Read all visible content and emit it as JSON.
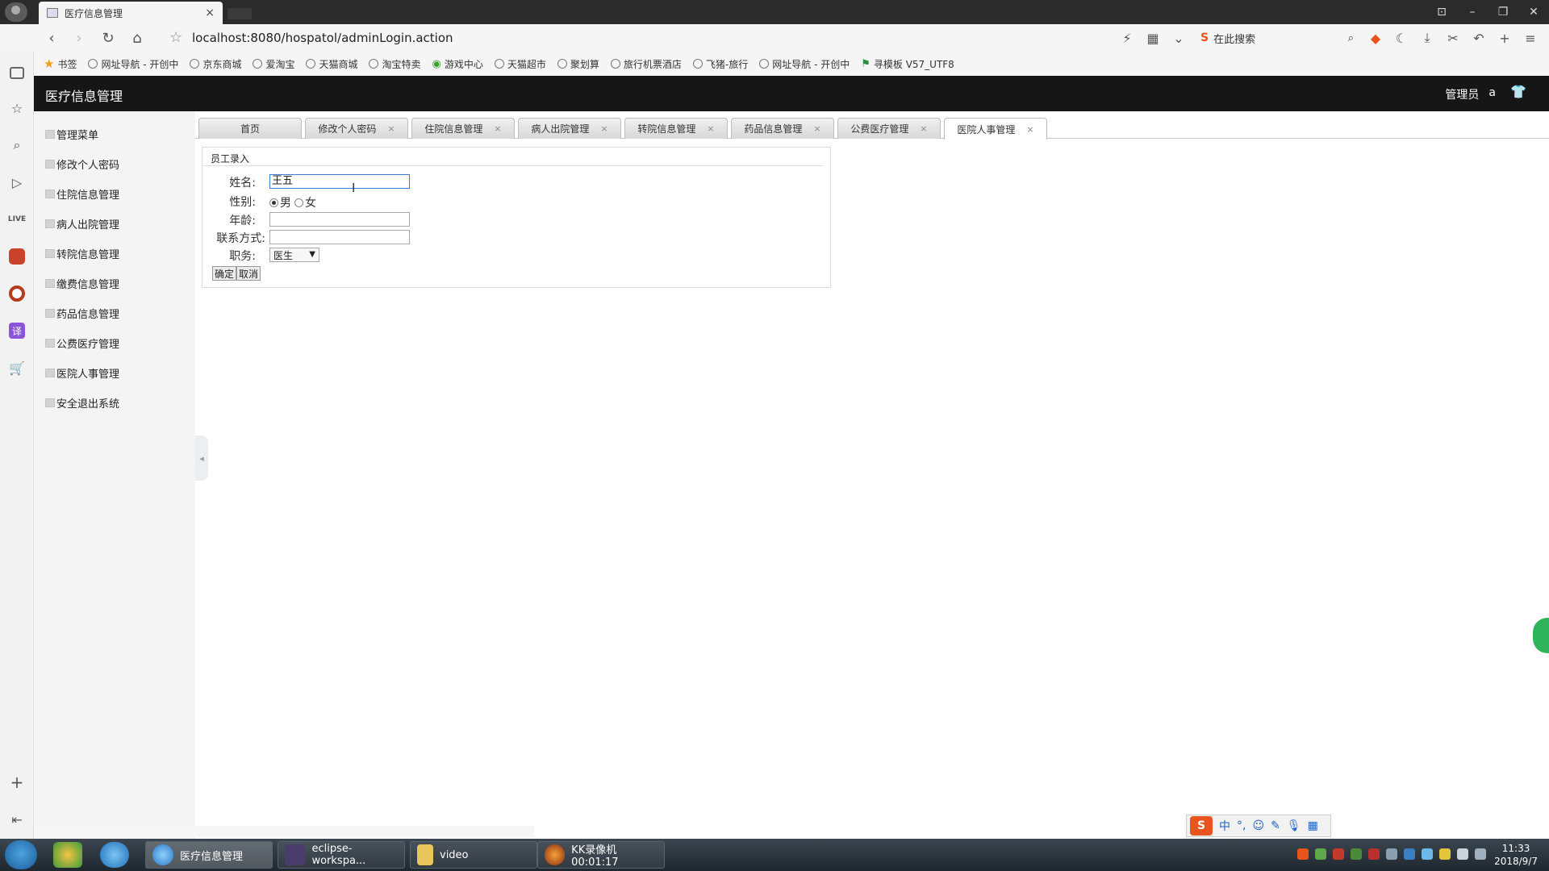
{
  "browser": {
    "tab_title": "医疗信息管理",
    "tab_close": "×",
    "url": "localhost:8080/hospatol/adminLogin.action",
    "search_placeholder": "在此搜索",
    "window_buttons": [
      "⊡",
      "–",
      "❐",
      "✕"
    ],
    "nav_icons": [
      "back-icon",
      "forward-icon",
      "reload-icon",
      "home-icon"
    ]
  },
  "bookmarks": [
    {
      "label": "书签",
      "icon": "star-icon"
    },
    {
      "label": "网址导航 - 开创中",
      "icon": "globe-icon"
    },
    {
      "label": "京东商城",
      "icon": "globe-icon"
    },
    {
      "label": "爱淘宝",
      "icon": "globe-icon"
    },
    {
      "label": "天猫商城",
      "icon": "globe-icon"
    },
    {
      "label": "淘宝特卖",
      "icon": "globe-icon"
    },
    {
      "label": "游戏中心",
      "icon": "gamepad-icon"
    },
    {
      "label": "天猫超市",
      "icon": "globe-icon"
    },
    {
      "label": "聚划算",
      "icon": "globe-icon"
    },
    {
      "label": "旅行机票酒店",
      "icon": "globe-icon"
    },
    {
      "label": "飞猪-旅行",
      "icon": "globe-icon"
    },
    {
      "label": "网址导航 - 开创中",
      "icon": "globe-icon"
    },
    {
      "label": "寻模板 V57_UTF8",
      "icon": "flag-icon"
    }
  ],
  "app": {
    "title": "医疗信息管理",
    "user_role": "管理员",
    "user_name": "a",
    "dropdown_glyph": "∨"
  },
  "sidebar": {
    "items": [
      {
        "label": "管理菜单"
      },
      {
        "label": "修改个人密码"
      },
      {
        "label": "住院信息管理"
      },
      {
        "label": "病人出院管理"
      },
      {
        "label": "转院信息管理"
      },
      {
        "label": "缴费信息管理"
      },
      {
        "label": "药品信息管理"
      },
      {
        "label": "公费医疗管理"
      },
      {
        "label": "医院人事管理"
      },
      {
        "label": "安全退出系统"
      }
    ]
  },
  "tabs": [
    {
      "label": "首页",
      "closable": false
    },
    {
      "label": "修改个人密码",
      "closable": true
    },
    {
      "label": "住院信息管理",
      "closable": true
    },
    {
      "label": "病人出院管理",
      "closable": true
    },
    {
      "label": "转院信息管理",
      "closable": true
    },
    {
      "label": "药品信息管理",
      "closable": true
    },
    {
      "label": "公费医疗管理",
      "closable": true
    },
    {
      "label": "医院人事管理",
      "closable": true,
      "active": true
    }
  ],
  "form": {
    "title": "员工录入",
    "name_label": "姓名:",
    "name_value": "王五",
    "gender_label": "性别:",
    "gender_male": "男",
    "gender_female": "女",
    "gender_selected": "男",
    "age_label": "年龄:",
    "age_value": "",
    "contact_label": "联系方式:",
    "contact_value": "",
    "position_label": "职务:",
    "position_value": "医生",
    "confirm_label": "确定",
    "cancel_label": "取消"
  },
  "ime": {
    "logo": "S",
    "mode": "中"
  },
  "taskbar": {
    "items": [
      {
        "label": "医疗信息管理",
        "active": true
      },
      {
        "label": "eclipse-workspa..."
      },
      {
        "label": "video"
      },
      {
        "label": "KK录像机 00:01:17"
      }
    ],
    "time": "11:33",
    "date": "2018/9/7"
  },
  "colors": {
    "app_header_bg": "#161616",
    "sidebar_bg": "#f4f4f4",
    "input_focus": "#3a7bd5",
    "ime_brand": "#e8541e"
  }
}
